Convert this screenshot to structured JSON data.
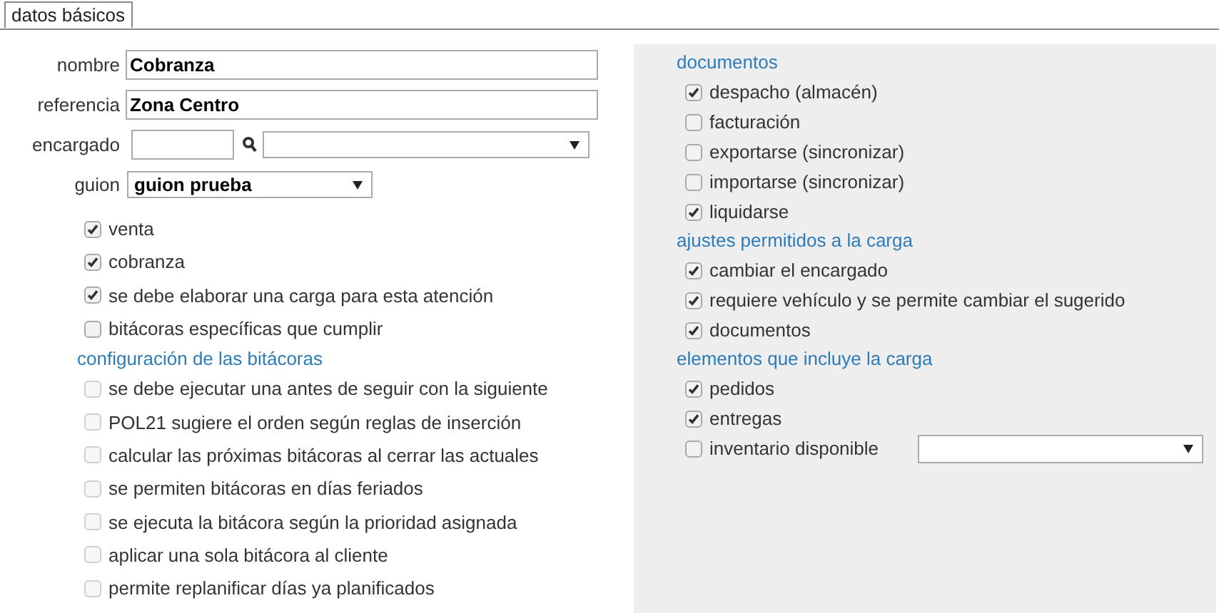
{
  "tabs": [
    {
      "label": "datos básicos",
      "selected": true
    }
  ],
  "fields": [
    {
      "kind": "text",
      "label": "nombre",
      "value": "Cobranza"
    },
    {
      "kind": "text",
      "label": "referencia",
      "value": "Zona Centro"
    },
    {
      "kind": "lookup",
      "label": "encargado"
    },
    {
      "kind": "select",
      "label": "guion",
      "value": "guion prueba"
    }
  ],
  "options": [
    {
      "label": "venta",
      "checked": true,
      "disabled": false
    },
    {
      "label": "cobranza",
      "checked": true,
      "disabled": false
    },
    {
      "label": "se debe elaborar una carga para esta atención",
      "checked": true,
      "disabled": false
    },
    {
      "label": "bitácoras específicas que cumplir",
      "checked": false,
      "disabled": false
    }
  ],
  "log_config": {
    "title": "configuración de las bitácoras",
    "items": [
      {
        "label": "se debe ejecutar una antes de seguir con la siguiente",
        "checked": false,
        "disabled": true
      },
      {
        "label": "POL21 sugiere el orden según reglas de inserción",
        "checked": false,
        "disabled": true
      },
      {
        "label": "calcular las próximas bitácoras al cerrar las actuales",
        "checked": false,
        "disabled": true
      },
      {
        "label": "se permiten bitácoras en días feriados",
        "checked": false,
        "disabled": true
      },
      {
        "label": "se ejecuta la bitácora según la prioridad asignada",
        "checked": false,
        "disabled": true
      },
      {
        "label": "aplicar una sola bitácora al cliente",
        "checked": false,
        "disabled": true
      },
      {
        "label": "permite replanificar días ya planificados",
        "checked": false,
        "disabled": true
      }
    ]
  },
  "load_sections": [
    {
      "title": "documentos",
      "items": [
        {
          "label": "despacho (almacén)",
          "checked": true
        },
        {
          "label": "facturación",
          "checked": false
        },
        {
          "label": "exportarse (sincronizar)",
          "checked": false
        },
        {
          "label": "importarse (sincronizar)",
          "checked": false
        },
        {
          "label": "liquidarse",
          "checked": true
        }
      ]
    },
    {
      "title": "ajustes permitidos a la carga",
      "items": [
        {
          "label": "cambiar el encargado",
          "checked": true
        },
        {
          "label": "requiere vehículo y se permite cambiar el sugerido",
          "checked": true
        },
        {
          "label": "documentos",
          "checked": true
        }
      ]
    },
    {
      "title": "elementos que incluye la carga",
      "items": [
        {
          "label": "pedidos",
          "checked": true
        },
        {
          "label": "entregas",
          "checked": true
        },
        {
          "label": "inventario disponible",
          "checked": false,
          "has_select": true
        }
      ]
    }
  ]
}
